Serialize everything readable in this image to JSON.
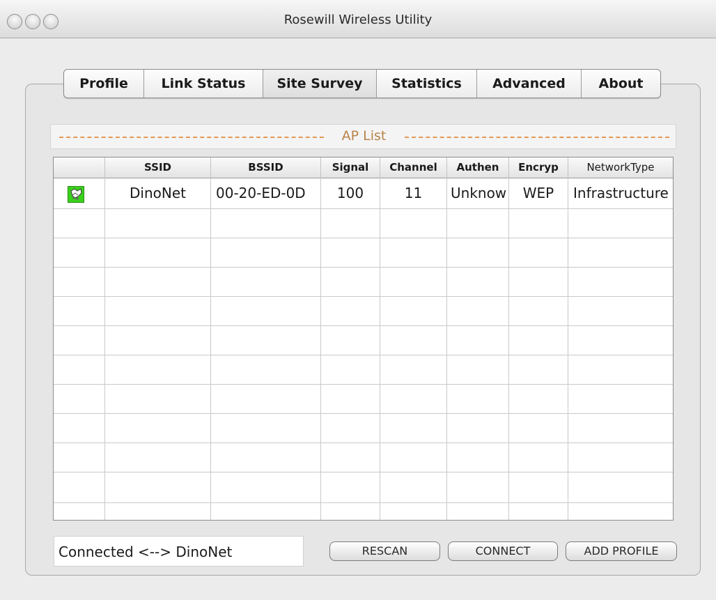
{
  "window": {
    "title": "Rosewill Wireless Utility"
  },
  "tabs": [
    {
      "label": "Profile",
      "active": false
    },
    {
      "label": "Link Status",
      "active": false
    },
    {
      "label": "Site Survey",
      "active": true
    },
    {
      "label": "Statistics",
      "active": false
    },
    {
      "label": "Advanced",
      "active": false
    },
    {
      "label": "About",
      "active": false
    }
  ],
  "ap_list": {
    "title": "AP List",
    "columns": [
      "",
      "SSID",
      "BSSID",
      "Signal",
      "Channel",
      "Authen",
      "Encryp",
      "NetworkType"
    ],
    "rows": [
      {
        "icon": "connected-network-icon",
        "ssid": "DinoNet",
        "bssid": "00-20-ED-0D",
        "signal": "100",
        "channel": "11",
        "authen": "Unknow",
        "encryp": "WEP",
        "network_type": "Infrastructure"
      }
    ]
  },
  "status": {
    "text": "Connected <--> DinoNet"
  },
  "buttons": {
    "rescan": "RESCAN",
    "connect": "CONNECT",
    "add_profile": "ADD PROFILE"
  },
  "colors": {
    "accent_orange": "#e39a55",
    "connected_icon_green": "#3ad11c"
  }
}
